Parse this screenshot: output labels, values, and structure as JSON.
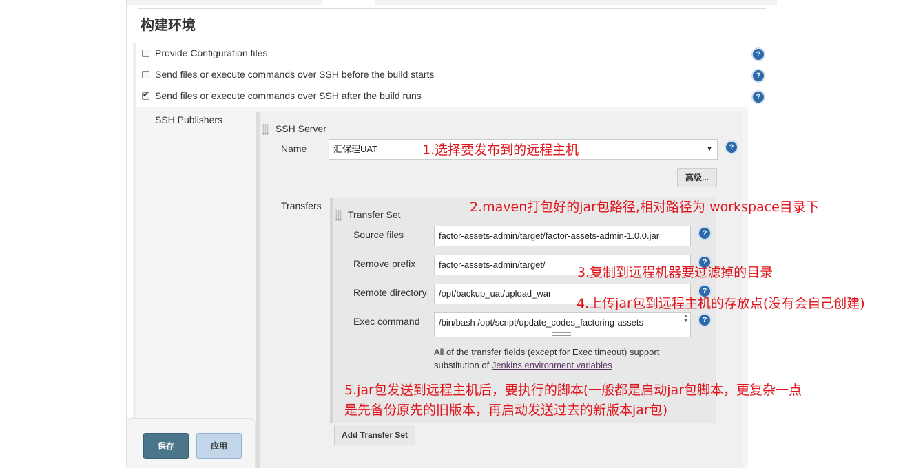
{
  "section": {
    "title": "构建环境"
  },
  "options": [
    {
      "label": "Provide Configuration files",
      "checked": false
    },
    {
      "label": "Send files or execute commands over SSH before the build starts",
      "checked": false
    },
    {
      "label": "Send files or execute commands over SSH after the build runs",
      "checked": true
    }
  ],
  "publishers": {
    "label": "SSH Publishers",
    "server": {
      "header": "SSH Server",
      "name_label": "Name",
      "name_value": "汇保理UAT",
      "advanced_button": "高级..."
    },
    "transfers_label": "Transfers",
    "transfer_set": {
      "header": "Transfer Set",
      "source_files_label": "Source files",
      "source_files_value": "factor-assets-admin/target/factor-assets-admin-1.0.0.jar",
      "remove_prefix_label": "Remove prefix",
      "remove_prefix_value": "factor-assets-admin/target/",
      "remote_directory_label": "Remote directory",
      "remote_directory_value": "/opt/backup_uat/upload_war",
      "exec_command_label": "Exec command",
      "exec_command_value": "/bin/bash /opt/script/update_codes_factoring-assets-",
      "note_line1": "All of the transfer fields (except for Exec timeout) support",
      "note_line2_prefix": "substitution of ",
      "note_link": "Jenkins environment variables"
    },
    "add_transfer_set_button": "Add Transfer Set"
  },
  "annotations": {
    "a1": "1.选择要发布到的远程主机",
    "a2": "2.maven打包好的jar包路径,相对路径为 workspace目录下",
    "a3": "3.复制到远程机器要过滤掉的目录",
    "a4": "4.上传jar包到远程主机的存放点(没有会自己创建)",
    "a5_line1": "5.jar包发送到远程主机后，要执行的脚本(一般都是启动jar包脚本，更复杂一点",
    "a5_line2": "是先备份原先的旧版本，再启动发送过去的新版本jar包)"
  },
  "footer": {
    "save": "保存",
    "apply": "应用"
  },
  "colors": {
    "annotation": "#e0141b",
    "save_bg": "#4b758b",
    "apply_bg": "#c2d6ea",
    "help_icon": "#2d6aab"
  }
}
